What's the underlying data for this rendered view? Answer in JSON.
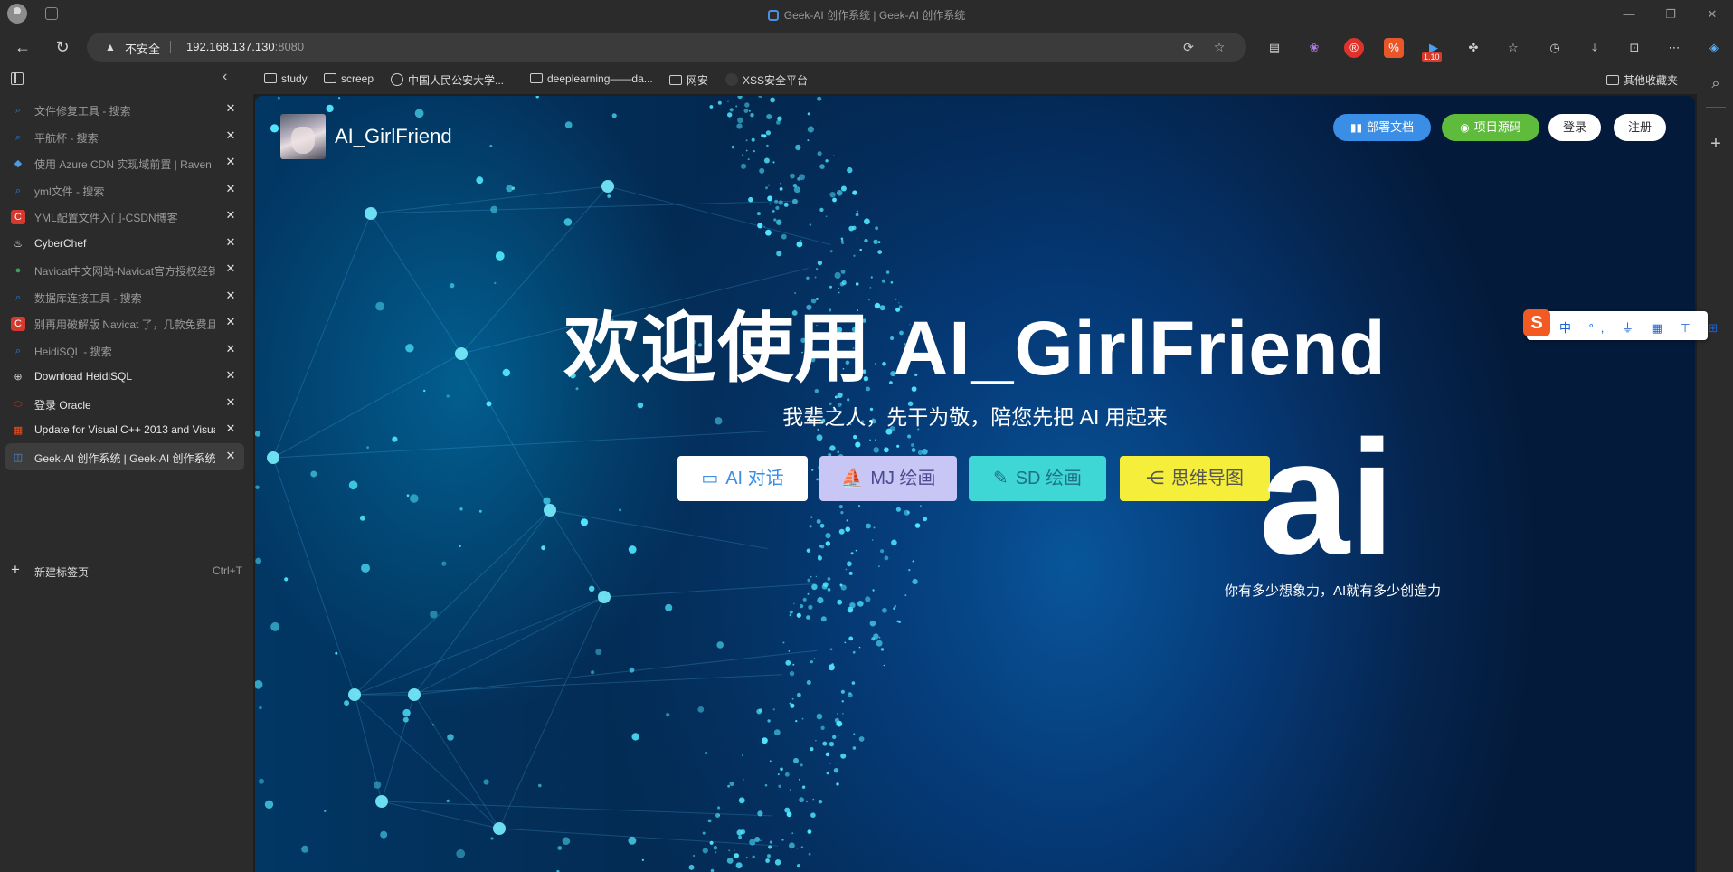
{
  "window": {
    "title": "Geek-AI 创作系统 | Geek-AI 创作系统",
    "controls": {
      "minimize": "—",
      "restore": "❐",
      "close": "✕"
    }
  },
  "toolbar": {
    "back_icon": "←",
    "refresh_icon": "↻",
    "security_label": "不安全",
    "url_host": "192.168.137.130",
    "url_port": ":8080",
    "ext_badge": "1.10"
  },
  "bookmarks": [
    {
      "label": "study",
      "icon": "folder"
    },
    {
      "label": "screep",
      "icon": "folder"
    },
    {
      "label": "中国人民公安大学...",
      "icon": "globe"
    },
    {
      "label": "deeplearning——da...",
      "icon": "folder"
    },
    {
      "label": "网安",
      "icon": "folder"
    },
    {
      "label": "XSS安全平台",
      "icon": "blank"
    },
    {
      "label": "其他收藏夹",
      "icon": "folder"
    }
  ],
  "tabs": [
    {
      "label": "文件修复工具 - 搜索",
      "icon": "search-icon",
      "color": "#2a7de1"
    },
    {
      "label": "平航杯 - 搜索",
      "icon": "search-icon",
      "color": "#2a7de1"
    },
    {
      "label": "使用 Azure CDN 实现域前置 | Raven M",
      "icon": "cube-icon",
      "color": "#4a9be0"
    },
    {
      "label": "yml文件 - 搜索",
      "icon": "search-icon",
      "color": "#2a7de1"
    },
    {
      "label": "YML配置文件入门-CSDN博客",
      "icon": "csdn-icon",
      "color": "#d23a2e"
    },
    {
      "label": "CyberChef",
      "icon": "chef-icon",
      "color": "#ffffff"
    },
    {
      "label": "Navicat中文网站-Navicat官方授权经销",
      "icon": "navicat-icon",
      "color": "#3aa655"
    },
    {
      "label": "数据库连接工具 - 搜索",
      "icon": "search-icon",
      "color": "#2a7de1"
    },
    {
      "label": "别再用破解版 Navicat 了，几款免费且",
      "icon": "csdn-icon",
      "color": "#d23a2e"
    },
    {
      "label": "HeidiSQL - 搜索",
      "icon": "search-icon",
      "color": "#2a7de1"
    },
    {
      "label": "Download HeidiSQL",
      "icon": "globe-icon",
      "color": "#cfcfcf"
    },
    {
      "label": "登录 Oracle",
      "icon": "oracle-icon",
      "color": "#c0392b"
    },
    {
      "label": "Update for Visual C++ 2013 and Visua",
      "icon": "windows-icon",
      "color": "#f25022"
    },
    {
      "label": "Geek-AI 创作系统 | Geek-AI 创作系统",
      "icon": "geek-icon",
      "color": "#4a8fe0",
      "active": true
    }
  ],
  "newtab": {
    "label": "新建标签页",
    "shortcut": "Ctrl+T"
  },
  "page": {
    "site_title": "AI_GirlFriend",
    "header_buttons": {
      "docs": "部署文档",
      "source": "项目源码",
      "login": "登录",
      "register": "注册"
    },
    "hero_title": "欢迎使用 AI_GirlFriend",
    "hero_subtitle": "我辈之人，先干为敬，陪您先把 AI 用起来",
    "actions": {
      "chat": "AI 对话",
      "mj": "MJ 绘画",
      "sd": "SD 绘画",
      "mind": "思维导图"
    },
    "ai_letters": "ai",
    "slogan": "你有多少想象力，AI就有多少创造力"
  },
  "ime": {
    "logo": "S",
    "items": "中 °, ⏚ ▦ ⊤ ⊞ ⊛"
  },
  "colors": {
    "docs_button": "#3a8ee6",
    "source_button": "#5fbb3c",
    "mj_button": "#c7c6f5",
    "sd_button": "#3fd6d6",
    "mind_button": "#f5ee3a"
  }
}
